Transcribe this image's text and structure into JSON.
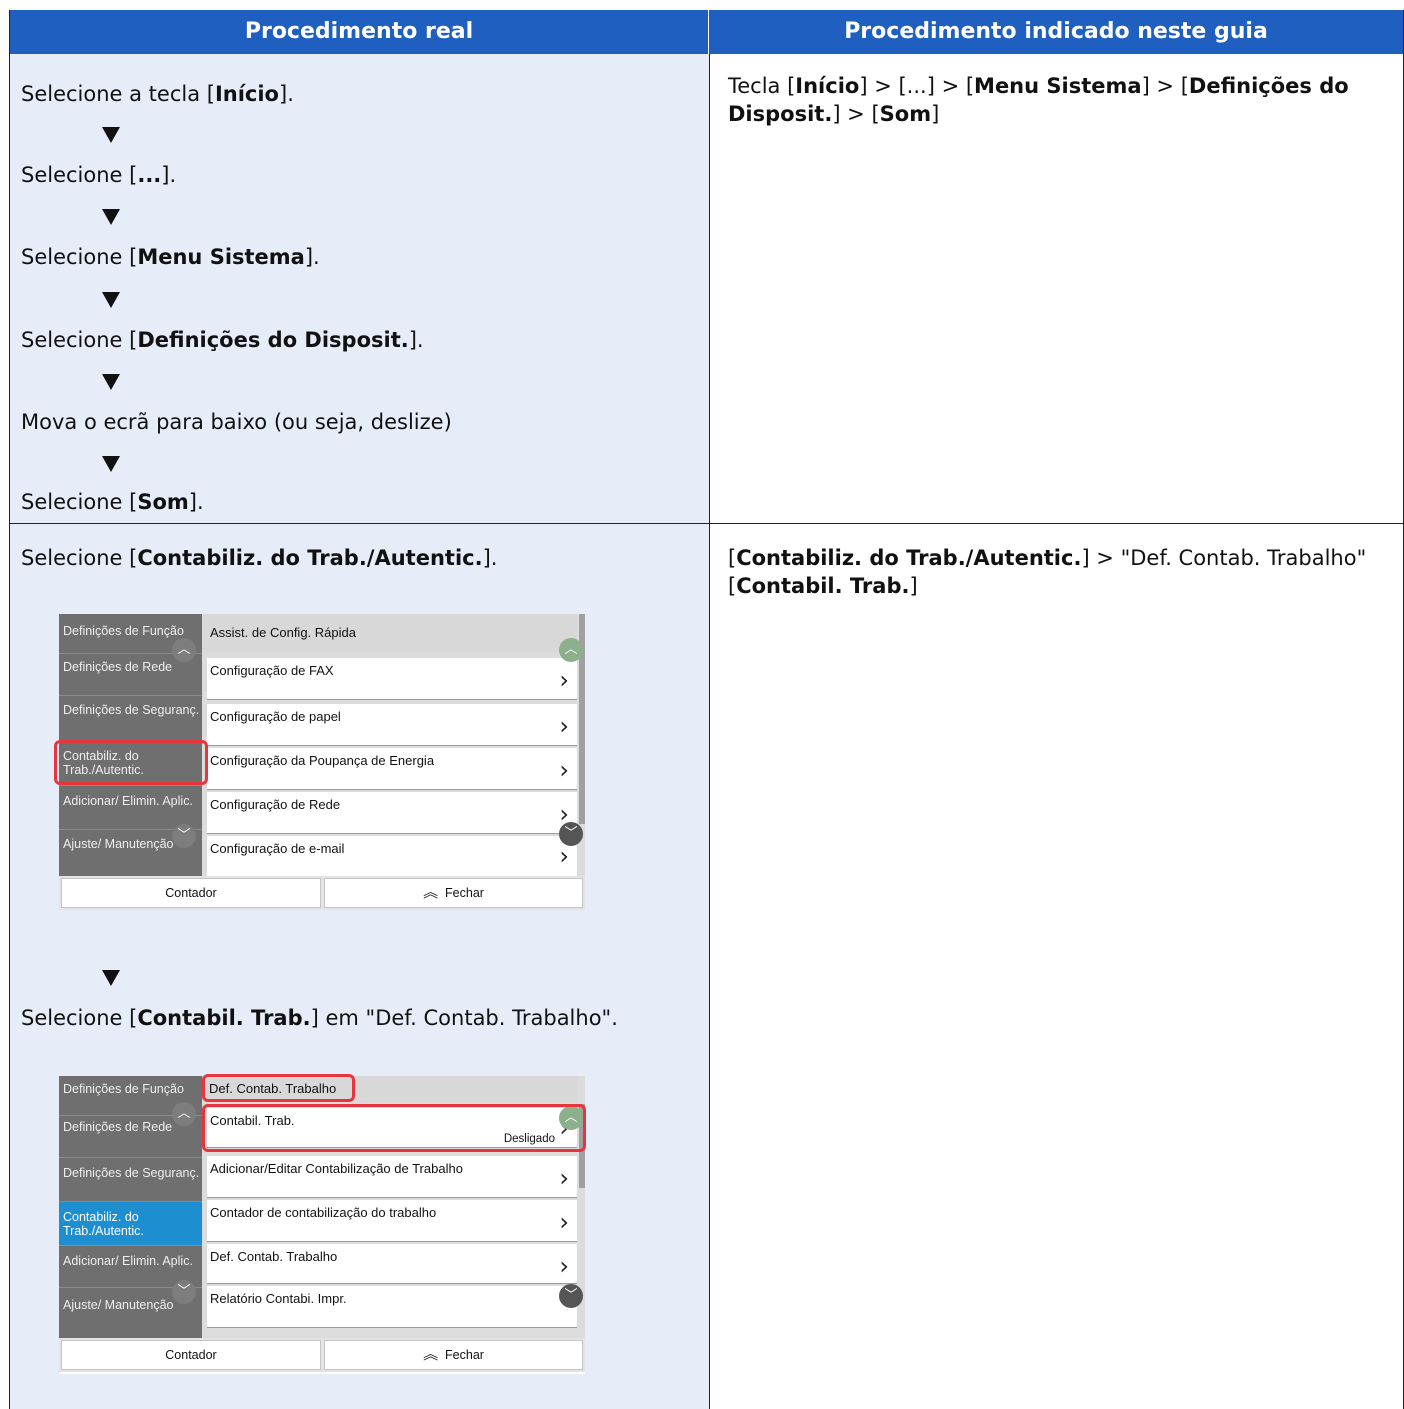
{
  "header": {
    "left": "Procedimento real",
    "right": "Procedimento indicado neste guia"
  },
  "row1": {
    "steps": [
      {
        "pre": "Selecione a tecla [",
        "bold": "Início",
        "post": "]."
      },
      {
        "pre": "Selecione [",
        "bold": "...",
        "post": "]."
      },
      {
        "pre": "Selecione [",
        "bold": "Menu Sistema",
        "post": "]."
      },
      {
        "pre": "Selecione [",
        "bold": "Definições do Disposit.",
        "post": "]."
      },
      {
        "pre": "Mova o ecrã para baixo (ou seja, deslize)",
        "bold": "",
        "post": ""
      },
      {
        "pre": "Selecione [",
        "bold": "Som",
        "post": "]."
      }
    ],
    "right": {
      "p1": "Tecla [",
      "b1": "Início",
      "p2": "]  > [...] > [",
      "b2": "Menu Sistema",
      "p3": "] > [",
      "b3": "Definições do Disposit.",
      "p4": "] > [",
      "b4": "Som",
      "p5": "]"
    }
  },
  "row2": {
    "step1": {
      "pre": "Selecione [",
      "bold": "Contabiliz. do Trab./Autentic.",
      "post": "]."
    },
    "step2": {
      "pre": "Selecione [",
      "bold": "Contabil. Trab.",
      "post": "] em \"Def. Contab. Trabalho\"."
    },
    "right": {
      "p1": "[",
      "b1": "Contabiliz. do Trab./Autentic.",
      "p2": "] > \"Def. Contab. Trabalho\"",
      "p3": "[",
      "b2": "Contabil. Trab.",
      "p4": "]"
    }
  },
  "panel1": {
    "side": [
      "Definições de Função",
      "Definições de Rede",
      "Definições de Seguranç.",
      "Contabiliz. do Trab./Autentic.",
      "Adicionar/ Elimin. Aplic.",
      "Ajuste/ Manutenção"
    ],
    "head": "Assist. de Config. Rápida",
    "items": [
      "Configuração de FAX",
      "Configuração de papel",
      "Configuração da Poupança de Energia",
      "Configuração de Rede",
      "Configuração de e-mail"
    ],
    "footer": [
      "Contador",
      "Fechar"
    ]
  },
  "panel2": {
    "side": [
      "Definições de Função",
      "Definições de Rede",
      "Definições de Seguranç.",
      "Contabiliz. do Trab./Autentic.",
      "Adicionar/ Elimin. Aplic.",
      "Ajuste/ Manutenção"
    ],
    "head": "Def. Contab. Trabalho",
    "items": [
      "Contabil. Trab.",
      "Adicionar/Editar Contabilização de Trabalho",
      "Contador de contabilização do trabalho",
      "Def. Contab. Trabalho",
      "Relatório Contabi. Impr."
    ],
    "item0_value": "Desligado",
    "footer": [
      "Contador",
      "Fechar"
    ]
  },
  "icons": {
    "arrow": "down-triangle-icon",
    "chevron": "chevron-right-icon",
    "up": "chevron-up-icon",
    "down": "chevron-down-icon",
    "close": "double-chevron-up-icon"
  }
}
